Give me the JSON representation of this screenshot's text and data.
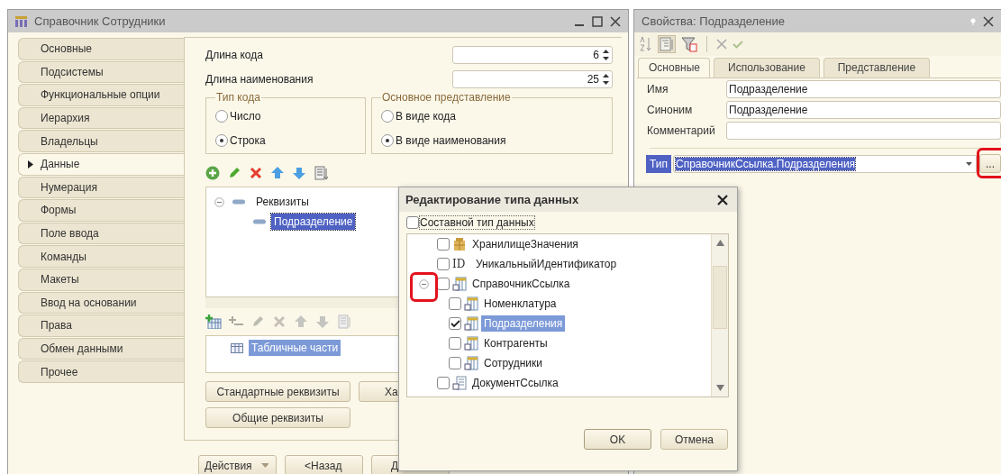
{
  "main_window": {
    "title": "Справочник Сотрудники",
    "sidebar": [
      {
        "label": "Основные",
        "selected": false
      },
      {
        "label": "Подсистемы",
        "selected": false
      },
      {
        "label": "Функциональные опции",
        "selected": false
      },
      {
        "label": "Иерархия",
        "selected": false
      },
      {
        "label": "Владельцы",
        "selected": false
      },
      {
        "label": "Данные",
        "selected": true
      },
      {
        "label": "Нумерация",
        "selected": false
      },
      {
        "label": "Формы",
        "selected": false
      },
      {
        "label": "Поле ввода",
        "selected": false
      },
      {
        "label": "Команды",
        "selected": false
      },
      {
        "label": "Макеты",
        "selected": false
      },
      {
        "label": "Ввод на основании",
        "selected": false
      },
      {
        "label": "Права",
        "selected": false
      },
      {
        "label": "Обмен данными",
        "selected": false
      },
      {
        "label": "Прочее",
        "selected": false
      }
    ],
    "number_fields": [
      {
        "label": "Длина кода",
        "value": "6"
      },
      {
        "label": "Длина наименования",
        "value": "25"
      }
    ],
    "option_groups": [
      {
        "title": "Тип кода",
        "options": [
          {
            "label": "Число",
            "selected": false
          },
          {
            "label": "Строка",
            "selected": true
          }
        ]
      },
      {
        "title": "Основное представление",
        "options": [
          {
            "label": "В виде кода",
            "selected": false
          },
          {
            "label": "В виде наименования",
            "selected": true
          }
        ]
      }
    ],
    "attributes_tree": [
      {
        "label": "Реквизиты",
        "expanded": true,
        "selected": false,
        "children": [
          {
            "label": "Подразделение",
            "selected": true
          }
        ]
      }
    ],
    "tabular_parts": [
      {
        "label": "Табличные части",
        "selected": true
      }
    ],
    "buttons": [
      "Стандартные реквизиты",
      "Ха",
      "Общие реквизиты"
    ],
    "footer_buttons": [
      {
        "label": "Действия",
        "kind": "menu"
      },
      {
        "label": "<Назад",
        "kind": "plain"
      },
      {
        "label": "Д",
        "kind": "plain"
      }
    ]
  },
  "properties": {
    "title": "Свойства: Подразделение",
    "tabs": [
      {
        "label": "Основные",
        "selected": true
      },
      {
        "label": "Использование",
        "selected": false
      },
      {
        "label": "Представление",
        "selected": false
      }
    ],
    "fields": [
      {
        "label": "Имя",
        "value": "Подразделение"
      },
      {
        "label": "Синоним",
        "value": "Подразделение"
      },
      {
        "label": "Комментарий"
      }
    ],
    "type": {
      "label": "Тип",
      "value": "СправочникСсылка.Подразделения",
      "select_button": "...",
      "highlighted": true
    }
  },
  "type_dialog": {
    "title": "Редактирование типа данных",
    "composite": {
      "label": "Составной тип данных",
      "checked": false
    },
    "types": [
      {
        "label": "ХранилищеЗначения",
        "kind": "storage",
        "checked": false,
        "selected": false
      },
      {
        "label": "УникальныйИдентификатор",
        "kind": "id",
        "badge": "ID",
        "checked": false,
        "selected": false
      },
      {
        "label": "СправочникСсылка",
        "kind": "catalog",
        "checked": false,
        "selected": false,
        "expanded": true,
        "highlighted": true,
        "children": [
          {
            "label": "Номенклатура",
            "kind": "catalog",
            "checked": false,
            "selected": false
          },
          {
            "label": "Подразделения",
            "kind": "catalog",
            "checked": true,
            "selected": true
          },
          {
            "label": "Контрагенты",
            "kind": "catalog",
            "checked": false,
            "selected": false
          },
          {
            "label": "Сотрудники",
            "kind": "catalog",
            "checked": false,
            "selected": false
          }
        ]
      },
      {
        "label": "ДокументСсылка",
        "kind": "document",
        "checked": false,
        "selected": false
      }
    ],
    "buttons": [
      "OK",
      "Отмена"
    ]
  }
}
